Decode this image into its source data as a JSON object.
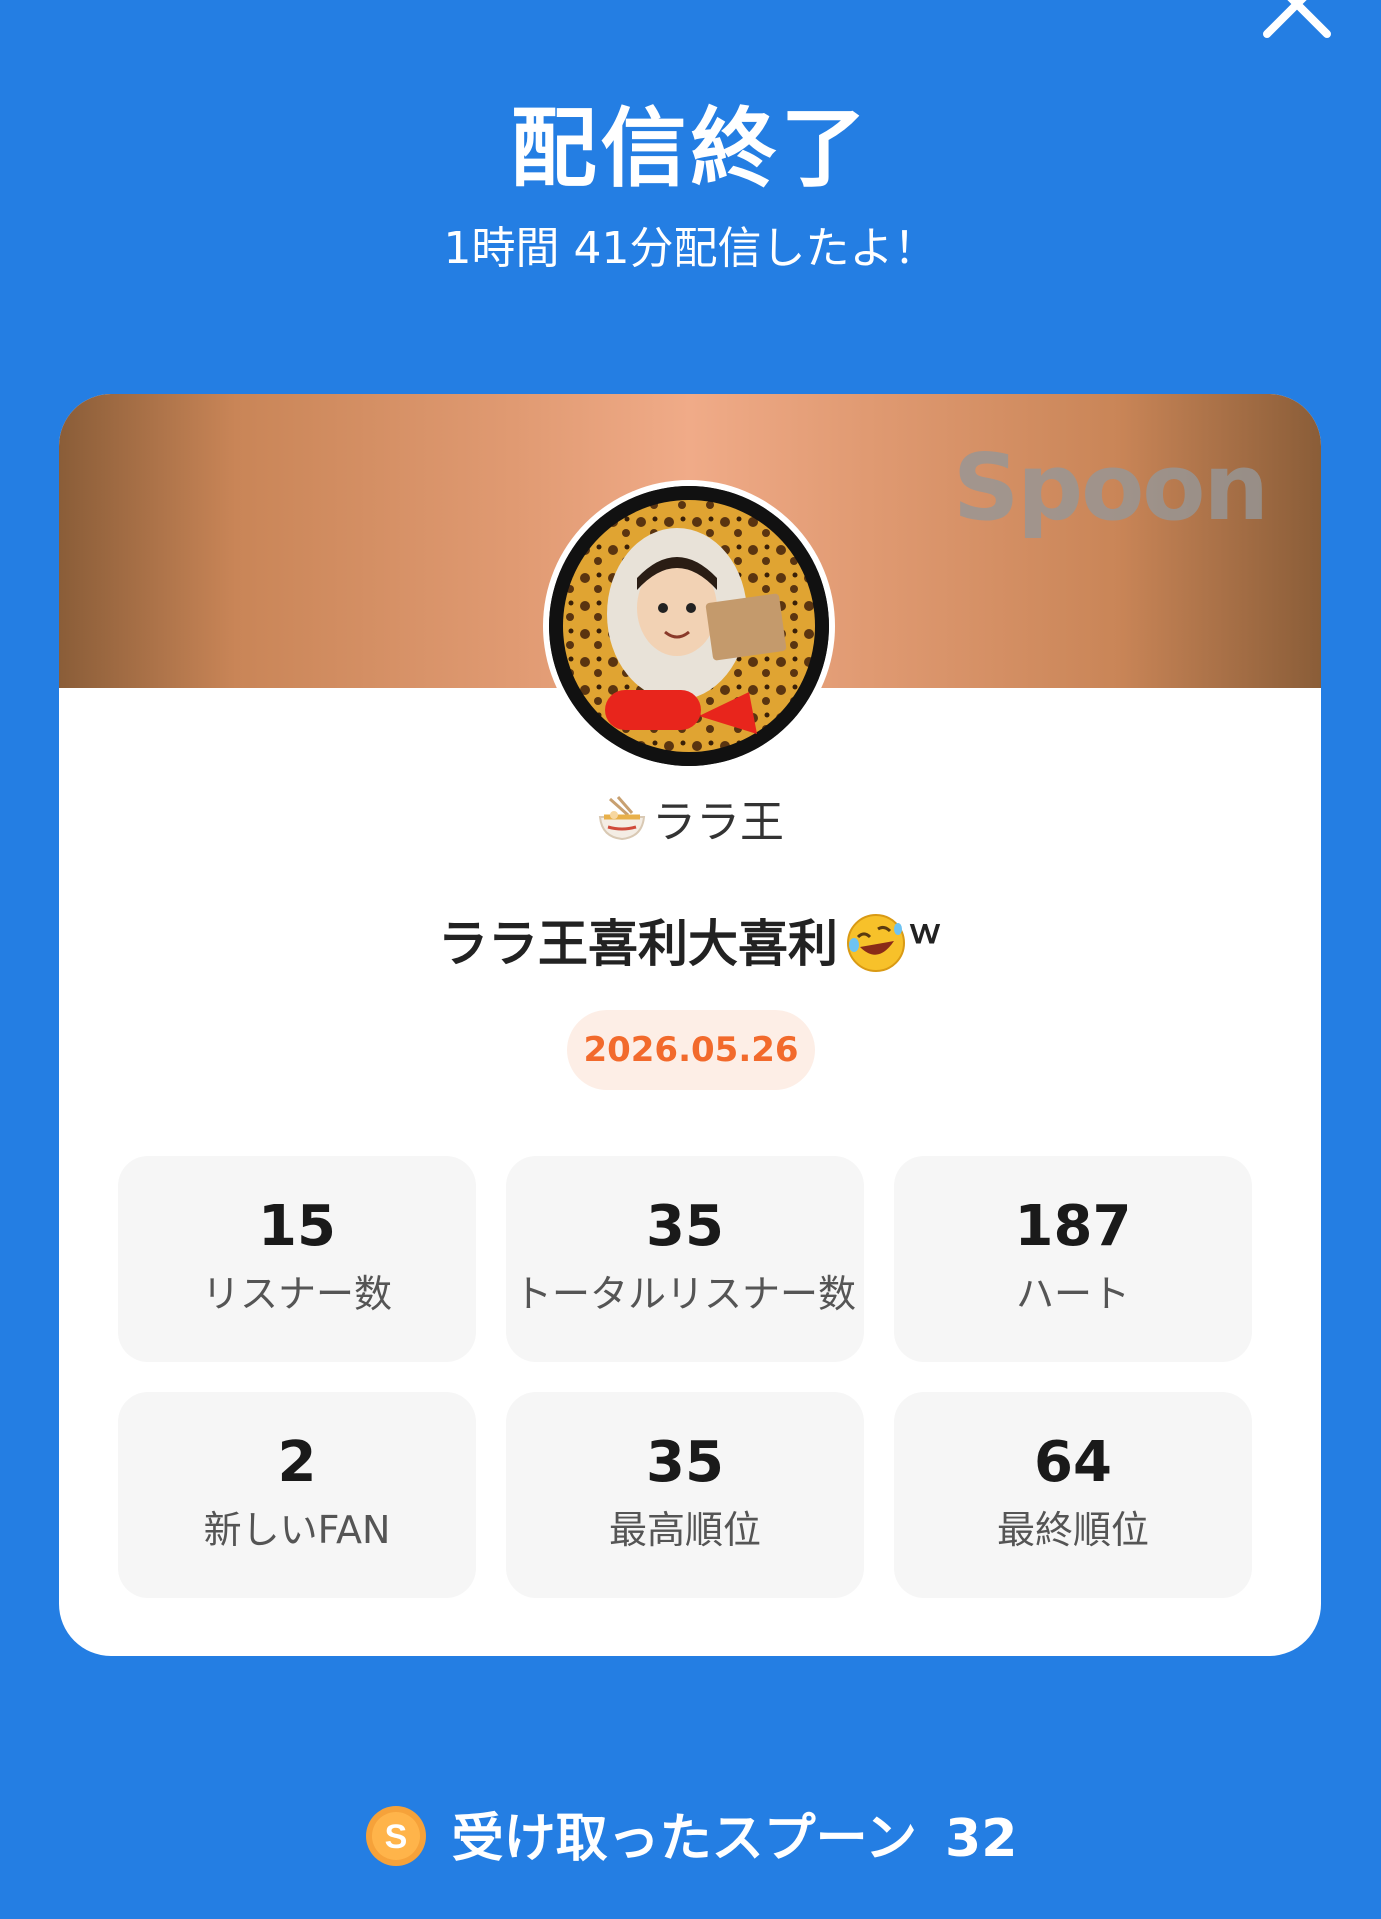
{
  "header": {
    "title": "配信終了",
    "subtitle": "1時間 41分配信したよ！"
  },
  "card": {
    "watermark": "Spoon",
    "host_name": "ララ王",
    "live_title": "ララ王喜利大喜利",
    "live_title_suffix": "ｗ",
    "date": "2026.05.26",
    "colors": {
      "accent_date": "#f26a2c",
      "date_bg": "#fdeee6"
    },
    "stats": [
      {
        "value": "15",
        "label": "リスナー数"
      },
      {
        "value": "35",
        "label": "トータルリスナー数"
      },
      {
        "value": "187",
        "label": "ハート"
      },
      {
        "value": "2",
        "label": "新しいFAN"
      },
      {
        "value": "35",
        "label": "最高順位"
      },
      {
        "value": "64",
        "label": "最終順位"
      }
    ]
  },
  "footer": {
    "coin_glyph": "S",
    "received_label": "受け取ったスプーン",
    "received_count": "32"
  },
  "theme": {
    "background": "#247ee3"
  },
  "icons": [
    "close-icon",
    "ramen-bowl-icon",
    "rofl-emoji-icon",
    "spoon-coin-icon"
  ]
}
